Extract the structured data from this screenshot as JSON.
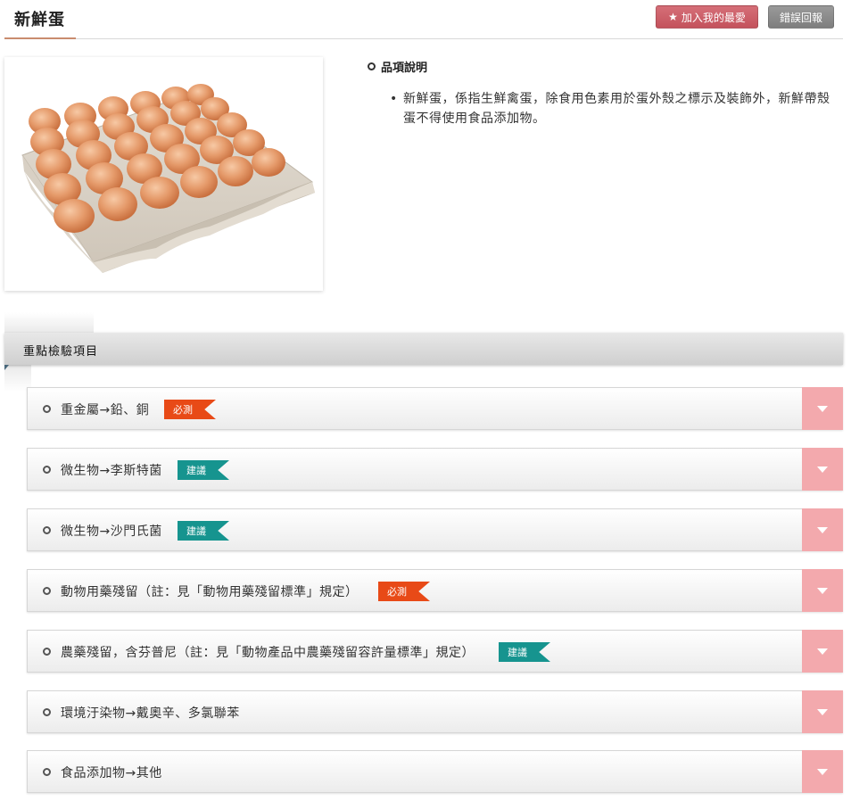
{
  "header": {
    "title": "新鮮蛋",
    "favorite_label": "加入我的最愛",
    "report_label": "錯誤回報"
  },
  "description": {
    "title": "品項說明",
    "bullet": "•",
    "text": "新鮮蛋，係指生鮮禽蛋，除食用色素用於蛋外殼之標示及裝飾外，新鮮帶殼蛋不得使用食品添加物。"
  },
  "section": {
    "title": "重點檢驗項目"
  },
  "badges": {
    "required": "必測",
    "suggest": "建議"
  },
  "items": [
    {
      "label": "重金屬→鉛、銅",
      "badge": "必測",
      "badge_type": "required"
    },
    {
      "label": "微生物→李斯特菌",
      "badge": "建議",
      "badge_type": "suggest"
    },
    {
      "label": "微生物→沙門氏菌",
      "badge": "建議",
      "badge_type": "suggest"
    },
    {
      "label": "動物用藥殘留（註：見「動物用藥殘留標準」規定）",
      "badge": "必測",
      "badge_type": "required"
    },
    {
      "label": "農藥殘留，含芬普尼（註：見「動物產品中農藥殘留容許量標準」規定）",
      "badge": "建議",
      "badge_type": "suggest"
    },
    {
      "label": "環境汙染物→戴奧辛、多氯聯苯",
      "badge": "",
      "badge_type": ""
    },
    {
      "label": "食品添加物→其他",
      "badge": "",
      "badge_type": ""
    }
  ],
  "colors": {
    "required": "#e84a17",
    "suggest": "#16948f",
    "toggle": "#f3a9ad",
    "favorite": "#c95a63"
  },
  "icons": {
    "favorite": "star-icon",
    "toggle": "chevron-down-icon",
    "bullet": "ring-bullet-icon"
  }
}
